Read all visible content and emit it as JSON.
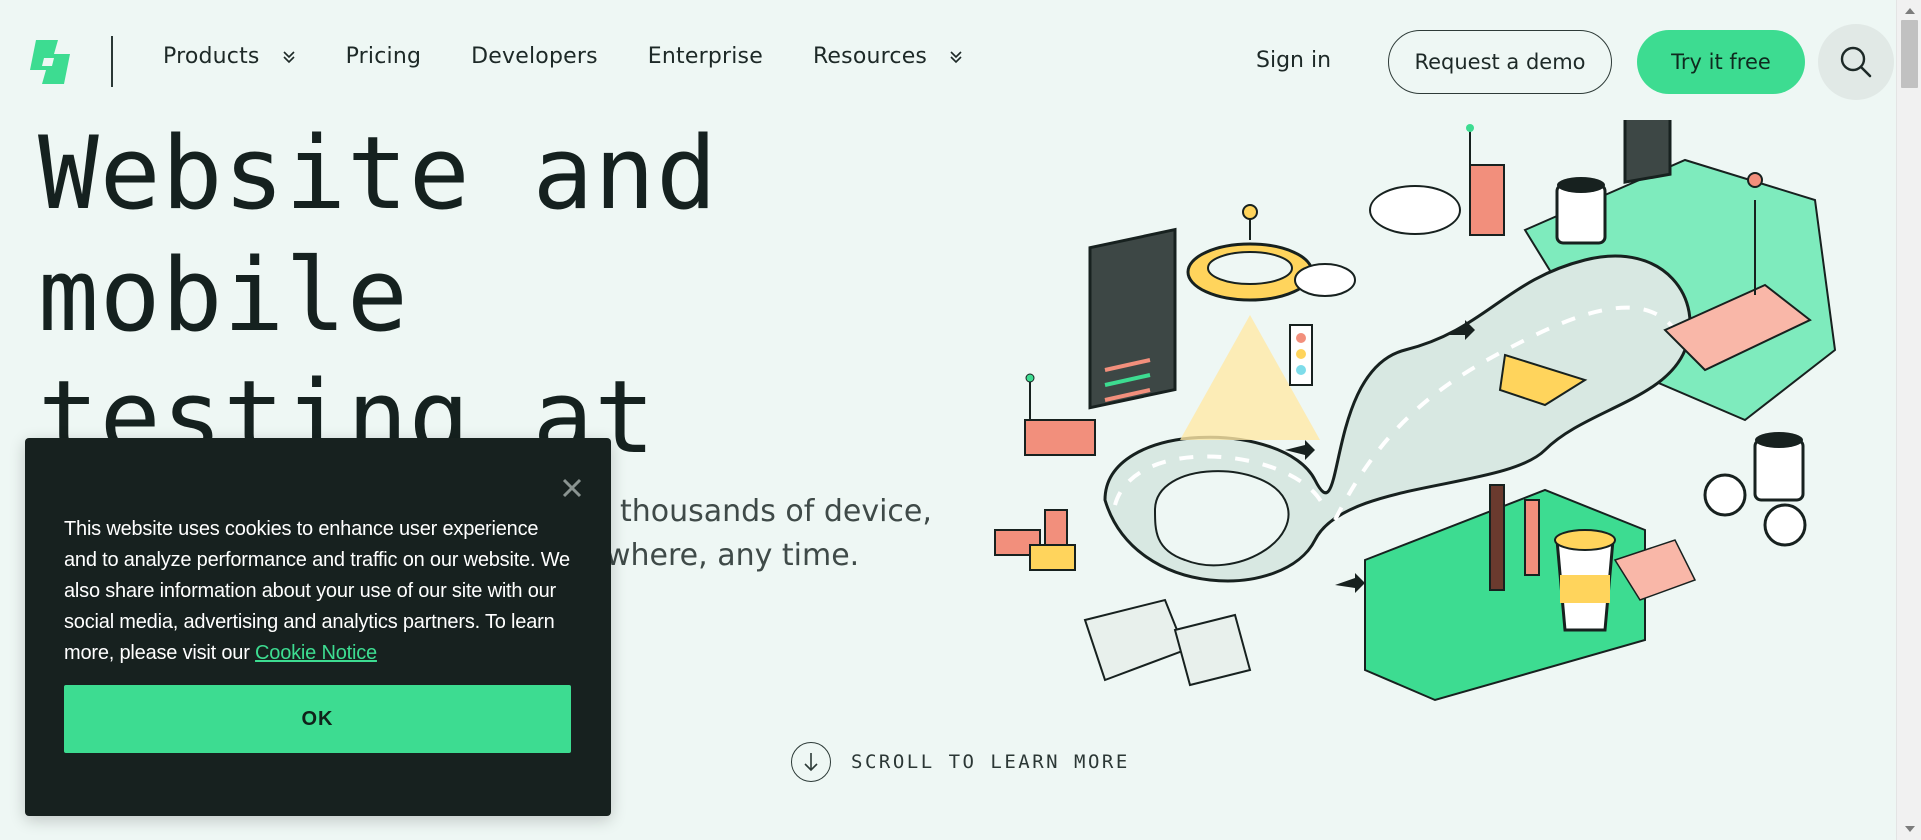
{
  "header": {
    "nav": [
      {
        "label": "Products",
        "has_dropdown": true
      },
      {
        "label": "Pricing",
        "has_dropdown": false
      },
      {
        "label": "Developers",
        "has_dropdown": false
      },
      {
        "label": "Enterprise",
        "has_dropdown": false
      },
      {
        "label": "Resources",
        "has_dropdown": true
      }
    ],
    "signin_label": "Sign in",
    "demo_label": "Request a demo",
    "try_label": "Try it free",
    "icons": {
      "logo": "brand-logo-icon",
      "search": "search-icon",
      "dropdown": "chevron-down-icon"
    }
  },
  "hero": {
    "title_line1": "Website and",
    "title_line2": "mobile",
    "title_line3": "testing at",
    "subtitle_line1": "thousands of device,",
    "subtitle_line2": "where, any time.",
    "scroll_hint": "SCROLL TO LEARN MORE"
  },
  "cookie": {
    "text": "This website uses cookies to enhance user experience and to analyze performance and traffic on our website. We also share information about your use of our site with our social media, advertising and analytics partners. To learn more, please visit our",
    "link_label": "Cookie Notice",
    "ok_label": "OK"
  },
  "colors": {
    "background": "#eef7f4",
    "accent": "#3ddc91",
    "dark": "#17211f"
  }
}
